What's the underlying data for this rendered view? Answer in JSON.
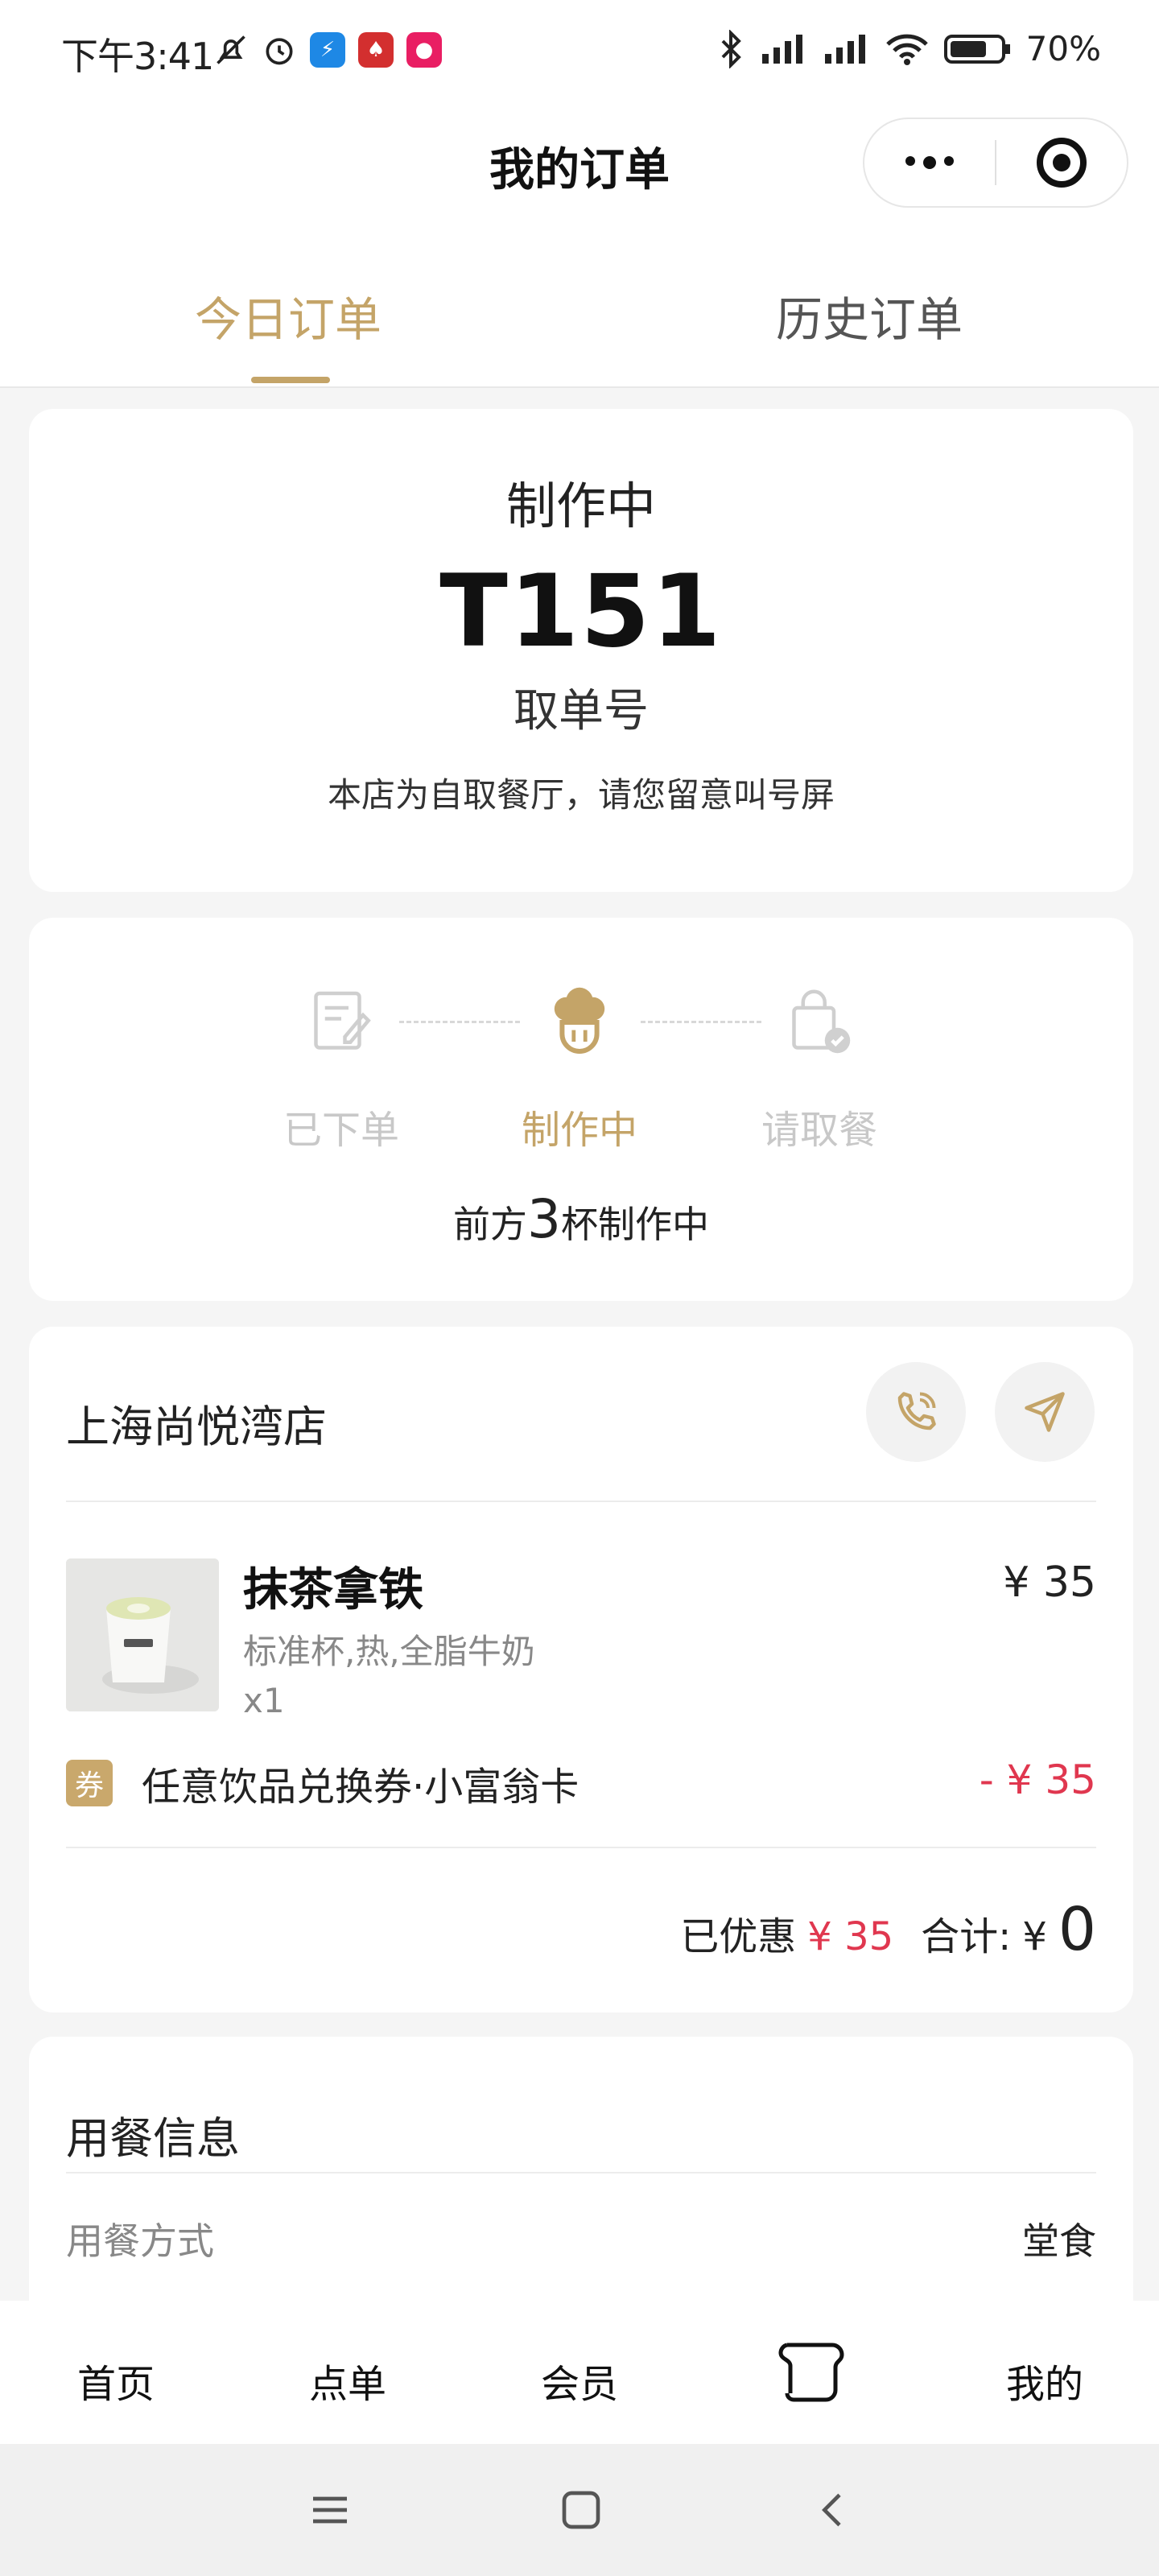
{
  "status_bar": {
    "time": "下午3:41",
    "battery": "70%"
  },
  "nav": {
    "title": "我的订单"
  },
  "tabs": [
    {
      "label": "今日订单",
      "active": true
    },
    {
      "label": "历史订单",
      "active": false
    }
  ],
  "order": {
    "status": "制作中",
    "number": "T151",
    "number_label": "取单号",
    "notice": "本店为自取餐厅，请您留意叫号屏"
  },
  "progress": {
    "steps": [
      {
        "label": "已下单",
        "icon": "order-note-icon"
      },
      {
        "label": "制作中",
        "icon": "chef-hat-icon"
      },
      {
        "label": "请取餐",
        "icon": "shopping-bag-check-icon"
      }
    ],
    "current_index": 1,
    "queue_prefix": "前方",
    "queue_count": "3",
    "queue_suffix": "杯制作中"
  },
  "store": {
    "name": "上海尚悦湾店"
  },
  "item": {
    "name": "抹茶拿铁",
    "spec": "标准杯,热,全脂牛奶",
    "qty": "x1",
    "price": "¥ 35"
  },
  "coupon": {
    "badge": "券",
    "name": "任意饮品兑换券·小富翁卡",
    "amount": "- ¥ 35"
  },
  "summary": {
    "discount_label": "已优惠",
    "discount_value": "¥ 35",
    "total_label": "合计:",
    "total_currency": "¥",
    "total_value": "0"
  },
  "dining": {
    "title": "用餐信息",
    "mode_label": "用餐方式",
    "mode_value": "堂食"
  },
  "tabbar": {
    "home": "首页",
    "order": "点单",
    "member": "会员",
    "mine": "我的"
  },
  "colors": {
    "accent": "#c4a468",
    "discount_red": "#e0374f"
  }
}
